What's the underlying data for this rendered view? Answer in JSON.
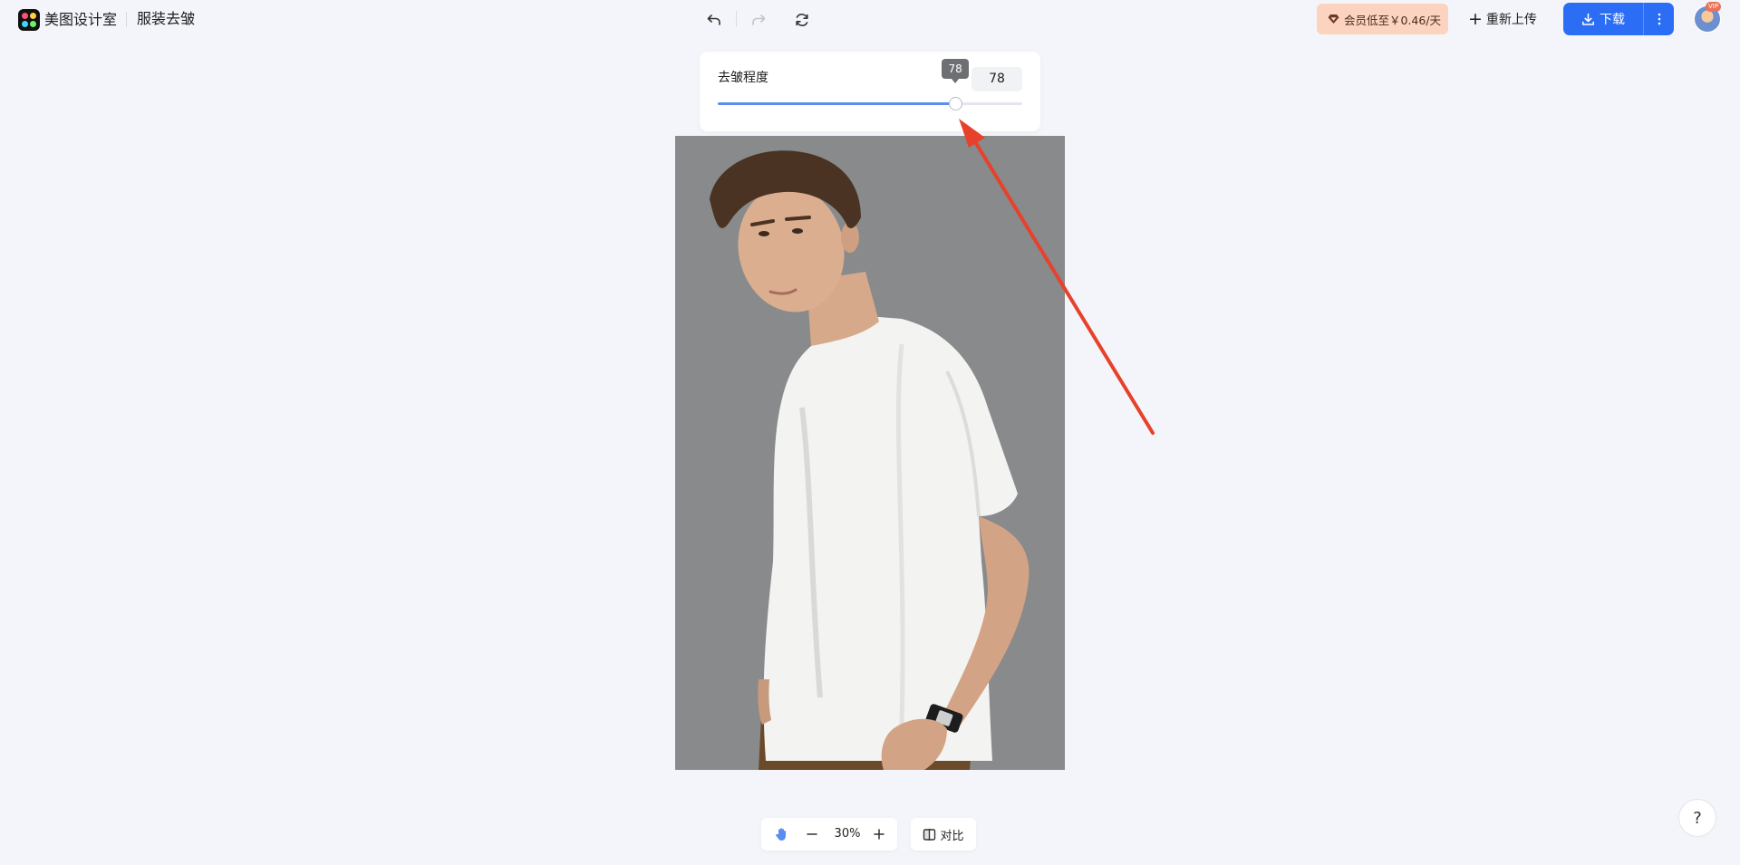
{
  "header": {
    "brand": "美图设计室",
    "page_title": "服装去皱",
    "vip_promo": "会员低至￥0.46/天",
    "reupload": "重新上传",
    "download": "下载",
    "vip_tag": "VIP"
  },
  "slider": {
    "label": "去皱程度",
    "value": "78",
    "tooltip": "78",
    "level_percent": 78
  },
  "zoom": {
    "value": "30%"
  },
  "compare_label": "对比",
  "help_label": "?",
  "colors": {
    "accent": "#2b6ef5",
    "promo_bg": "#fbd3bf",
    "arrow": "#e8412b",
    "photo_bg": "#888a8b"
  }
}
